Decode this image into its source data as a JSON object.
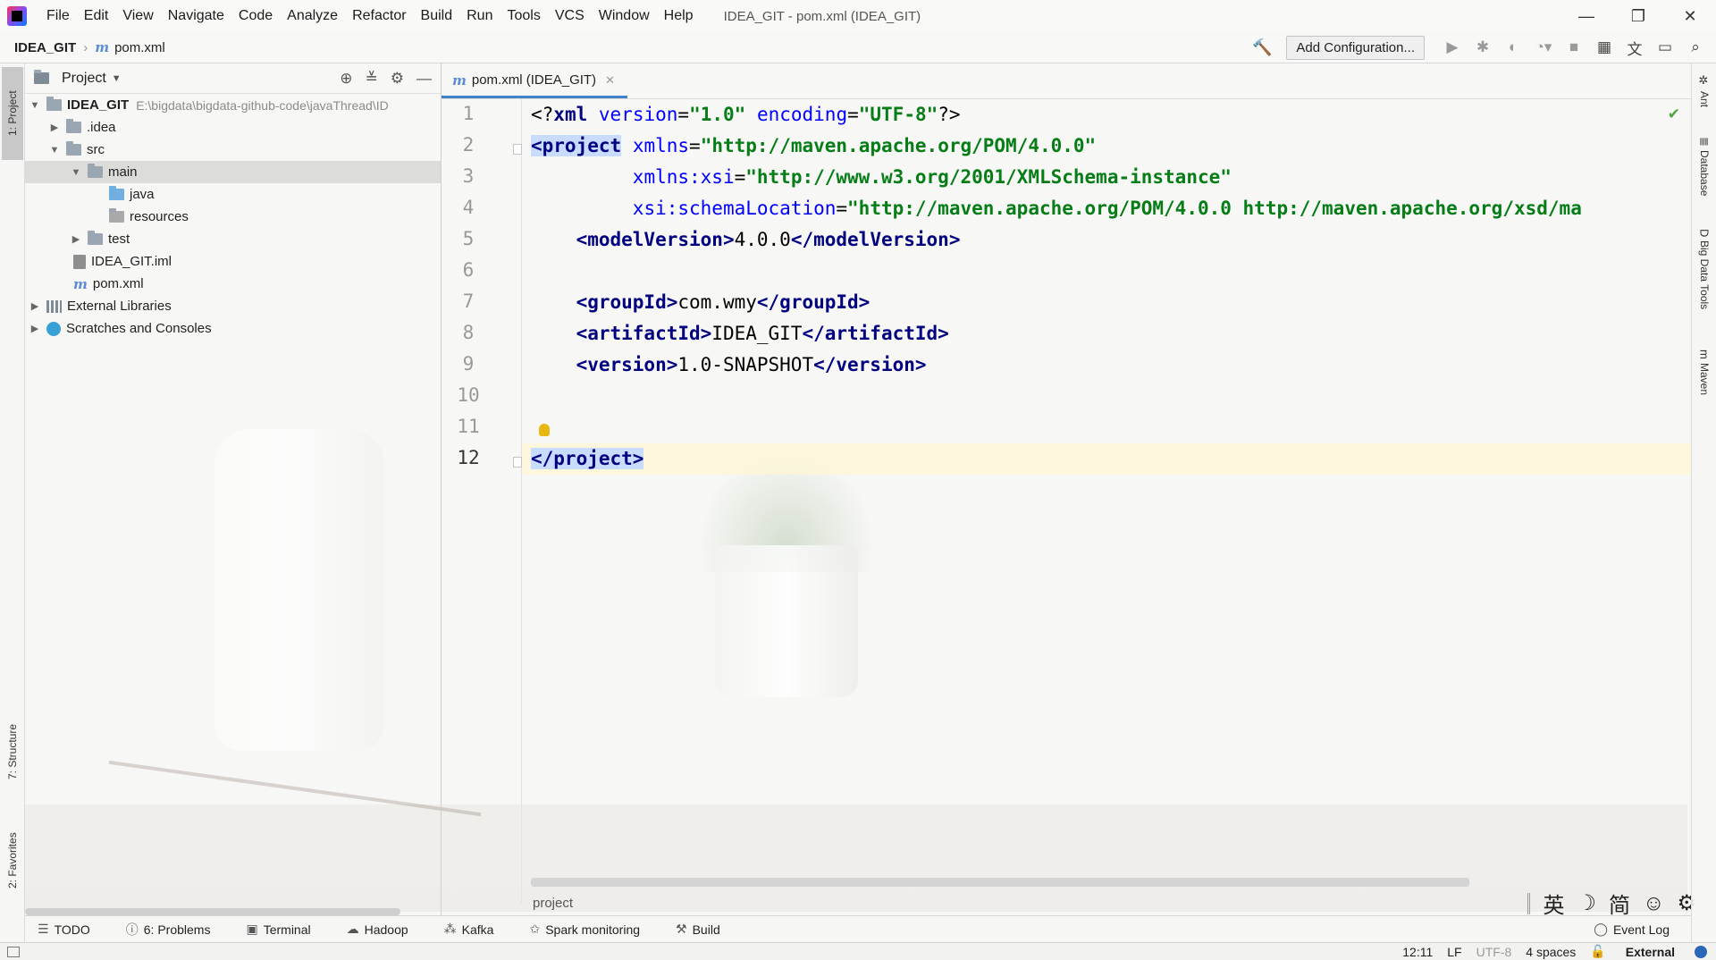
{
  "menubar": {
    "items": [
      "File",
      "Edit",
      "View",
      "Navigate",
      "Code",
      "Analyze",
      "Refactor",
      "Build",
      "Run",
      "Tools",
      "VCS",
      "Window",
      "Help"
    ],
    "window_title": "IDEA_GIT - pom.xml (IDEA_GIT)"
  },
  "navbar": {
    "project": "IDEA_GIT",
    "file": "pom.xml",
    "add_configuration": "Add Configuration..."
  },
  "left_stripe": {
    "project_tab": "1: Project",
    "structure_tab": "7: Structure",
    "favorites_tab": "2: Favorites"
  },
  "project_panel": {
    "title": "Project",
    "tree": [
      {
        "label": "IDEA_GIT",
        "hint": "E:\\bigdata\\bigdata-github-code\\javaThread\\ID"
      },
      {
        "label": ".idea"
      },
      {
        "label": "src"
      },
      {
        "label": "main"
      },
      {
        "label": "java"
      },
      {
        "label": "resources"
      },
      {
        "label": "test"
      },
      {
        "label": "IDEA_GIT.iml"
      },
      {
        "label": "pom.xml"
      },
      {
        "label": "External Libraries"
      },
      {
        "label": "Scratches and Consoles"
      }
    ]
  },
  "editor": {
    "tab_label": "pom.xml (IDEA_GIT)",
    "line_numbers": [
      "1",
      "2",
      "3",
      "4",
      "5",
      "6",
      "7",
      "8",
      "9",
      "10",
      "11",
      "12"
    ],
    "code": {
      "l1_open": "<?",
      "l1_xml": "xml",
      "l1_attr1": "version",
      "l1_eq": "=",
      "l1_val1": "\"1.0\"",
      "l1_attr2": "encoding",
      "l1_val2": "\"UTF-8\"",
      "l1_close": "?>",
      "l2_tag": "<project",
      "l2_attr": "xmlns",
      "l2_val": "\"http://maven.apache.org/POM/4.0.0\"",
      "l3_attr": "xmlns:xsi",
      "l3_val": "\"http://www.w3.org/2001/XMLSchema-instance\"",
      "l4_attr": "xsi:schemaLocation",
      "l4_val": "\"http://maven.apache.org/POM/4.0.0 http://maven.apache.org/xsd/ma",
      "l5_open": "<modelVersion>",
      "l5_text": "4.0.0",
      "l5_close": "</modelVersion>",
      "l7_open": "<groupId>",
      "l7_text": "com.wmy",
      "l7_close": "</groupId>",
      "l8_open": "<artifactId>",
      "l8_text": "IDEA_GIT",
      "l8_close": "</artifactId>",
      "l9_open": "<version>",
      "l9_text": "1.0-SNAPSHOT",
      "l9_close": "</version>",
      "l12_tag": "</project>"
    },
    "breadcrumb": "project"
  },
  "right_stripe": {
    "tabs": [
      "Ant",
      "Database",
      "Big Data Tools",
      "Maven"
    ]
  },
  "ime": {
    "items": [
      "英",
      "☽",
      "简",
      "☺",
      "⚙"
    ]
  },
  "bottom_bar": {
    "items": [
      "TODO",
      "6: Problems",
      "Terminal",
      "Hadoop",
      "Kafka",
      "Spark monitoring",
      "Build"
    ],
    "event_log": "Event Log"
  },
  "status_bar": {
    "position": "12:11",
    "line_sep": "LF",
    "encoding": "UTF-8",
    "indent": "4 spaces",
    "external": "External"
  },
  "colors": {
    "tag": "#000080",
    "attr": "#0000ff",
    "attr_value": "#067d17",
    "tab_underline": "#4083c9",
    "current_line": "#fcf6d6"
  }
}
